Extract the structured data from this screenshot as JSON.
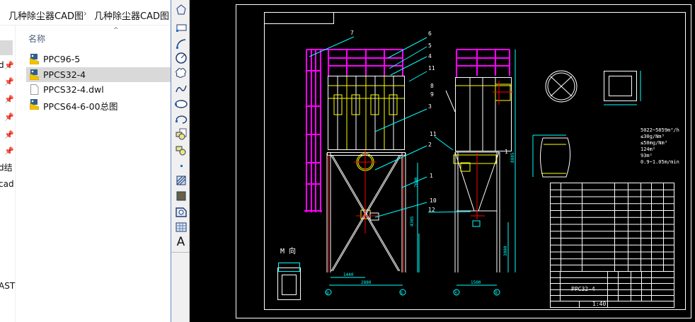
{
  "explorer": {
    "breadcrumb": [
      "几种除尘器CAD图",
      "几种除尘器CAD图"
    ],
    "breadcrumb_sep": "›",
    "nav_fragments": [
      "d",
      "d结",
      "cad",
      "AST"
    ],
    "column_header": "名称",
    "sort_indicator": "^",
    "files": [
      {
        "name": "PPC96-5",
        "icon": "autocad-drawing-icon",
        "selected": false
      },
      {
        "name": "PPCS32-4",
        "icon": "autocad-drawing-icon",
        "selected": true
      },
      {
        "name": "PPCS32-4.dwl",
        "icon": "blank-file-icon",
        "selected": false
      },
      {
        "name": "PPCS64-6-00总图",
        "icon": "autocad-drawing-icon",
        "selected": false
      }
    ]
  },
  "toolbar": {
    "tools": [
      "polygon-icon",
      "rectangle-icon",
      "arc-icon",
      "circle-icon",
      "revision-cloud-icon",
      "spline-icon",
      "ellipse-icon",
      "ellipse-arc-icon",
      "insert-block-icon",
      "make-block-icon",
      "point-icon",
      "hatch-icon",
      "gradient-icon",
      "region-icon",
      "table-icon",
      "multiline-text-icon"
    ],
    "text_tool_label": "A"
  },
  "drawing": {
    "part_labels": [
      "7",
      "6",
      "5",
      "4",
      "11",
      "8",
      "9",
      "3",
      "11",
      "2",
      "1",
      "10",
      "12",
      "1"
    ],
    "dimensions": [
      "1440",
      "2880",
      "1500",
      "4305",
      "7600",
      "8805",
      "3080"
    ],
    "axis_markers": [
      "②",
      "①",
      "Ⓐ",
      "Ⓑ"
    ],
    "view_label": "M 向",
    "specs": [
      "5022~5859m³/h",
      "≤30g/Nm³",
      "≤50mg/Nm³",
      "124m²",
      "93m²",
      "0.9~1.05m/min"
    ],
    "drawing_number": "PPC32-4",
    "scale": "1:40",
    "colors": {
      "background": "#000000",
      "outline": "#ffffff",
      "platform": "#ff00ff",
      "dimension": "#00ffff",
      "filter": "#ffff00",
      "centerline": "#ff0000"
    }
  }
}
